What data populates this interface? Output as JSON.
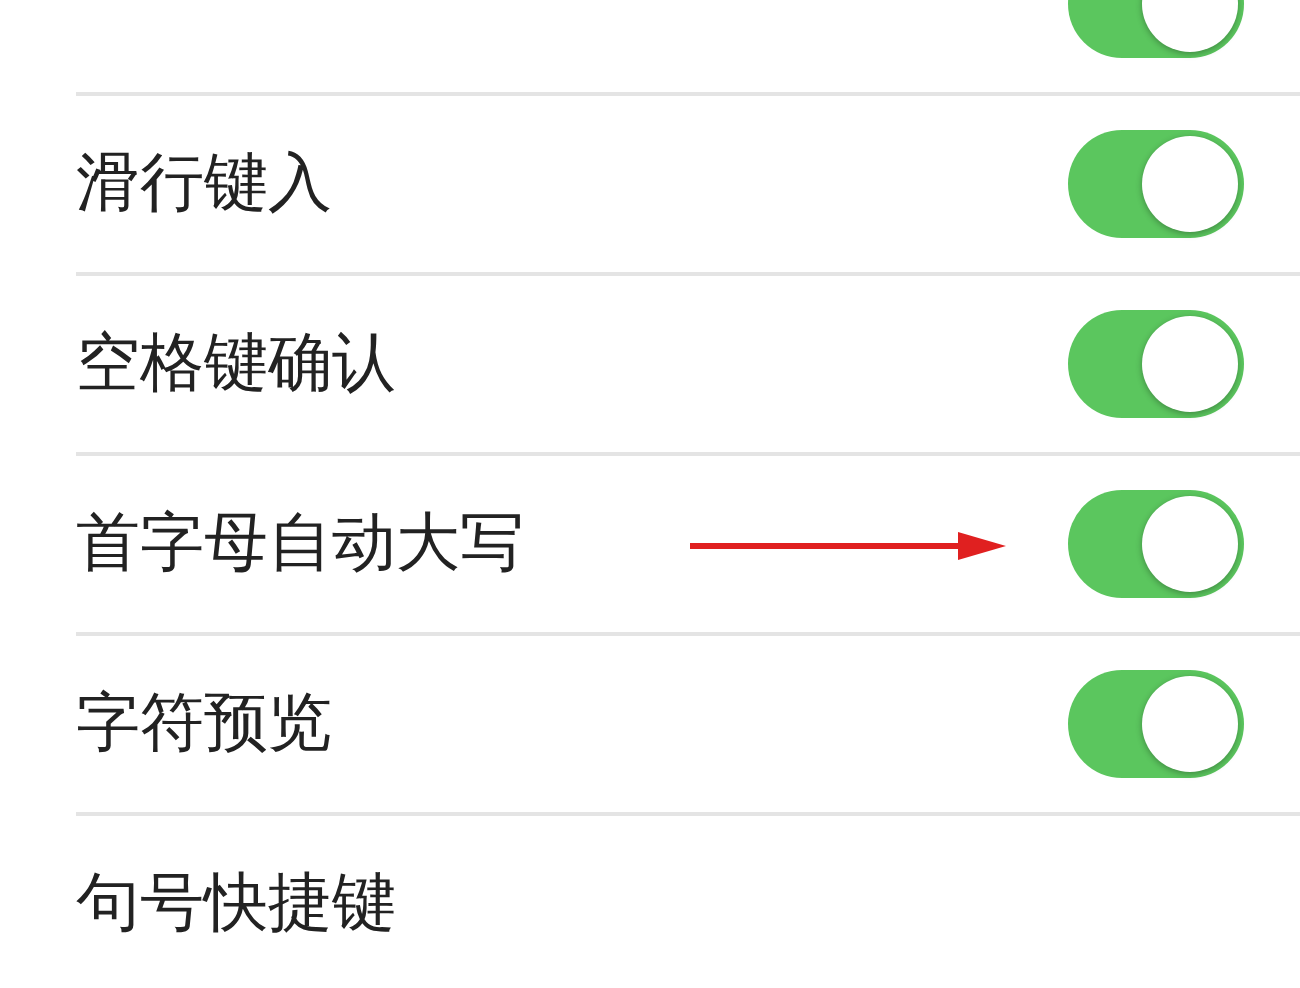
{
  "rows": [
    {
      "kind": "toggle",
      "on": true,
      "arrow": false
    },
    {
      "label": "滑行键入",
      "kind": "toggle",
      "on": true,
      "arrow": false
    },
    {
      "label": "空格键确认",
      "kind": "toggle",
      "on": true,
      "arrow": false
    },
    {
      "label": "首字母自动大写",
      "kind": "toggle",
      "on": true,
      "arrow": true
    },
    {
      "label": "字符预览",
      "kind": "toggle",
      "on": true,
      "arrow": false
    },
    {
      "label": "句号快捷键",
      "kind": "text",
      "arrow": false
    }
  ]
}
